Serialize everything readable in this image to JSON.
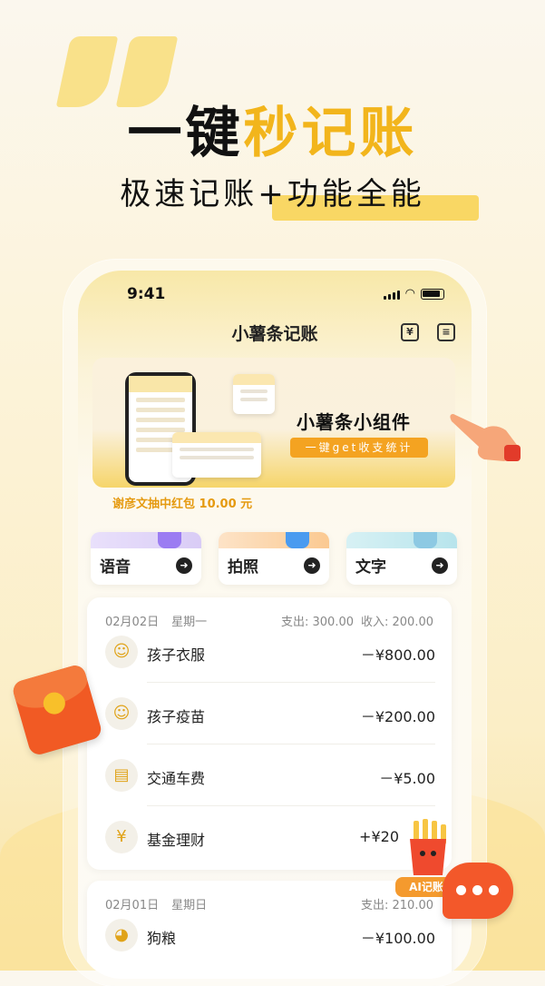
{
  "hero": {
    "title_black": "一键",
    "title_accent": "秒记账",
    "subtitle": "极速记账+功能全能"
  },
  "status_bar": {
    "time": "9:41"
  },
  "header": {
    "title": "小薯条记账",
    "yen_label": "¥"
  },
  "banner": {
    "title": "小薯条小组件",
    "pill": "一键get收支统计"
  },
  "promo": "谢彦文抽中红包 10.00 元",
  "quick_actions": [
    {
      "label": "语音",
      "icon": "microphone-icon"
    },
    {
      "label": "拍照",
      "icon": "camera-icon"
    },
    {
      "label": "文字",
      "icon": "keyboard-icon"
    }
  ],
  "days": [
    {
      "date": "02月02日",
      "weekday": "星期一",
      "expense": "支出: 300.00",
      "income": "收入: 200.00",
      "items": [
        {
          "icon": "child-face-icon",
          "name": "孩子衣服",
          "amount": "－¥800.00"
        },
        {
          "icon": "child-face-icon",
          "name": "孩子疫苗",
          "amount": "－¥200.00"
        },
        {
          "icon": "bus-icon",
          "name": "交通车费",
          "amount": "－¥5.00"
        },
        {
          "icon": "fund-icon",
          "name": "基金理财",
          "amount": "+¥20"
        }
      ]
    },
    {
      "date": "02月01日",
      "weekday": "星期日",
      "expense": "支出: 210.00",
      "items": [
        {
          "icon": "dog-icon",
          "name": "狗粮",
          "amount": "－¥100.00"
        }
      ]
    }
  ],
  "ai_badge": "AI记账",
  "colors": {
    "accent": "#f2b51c",
    "orange": "#f15a24"
  }
}
